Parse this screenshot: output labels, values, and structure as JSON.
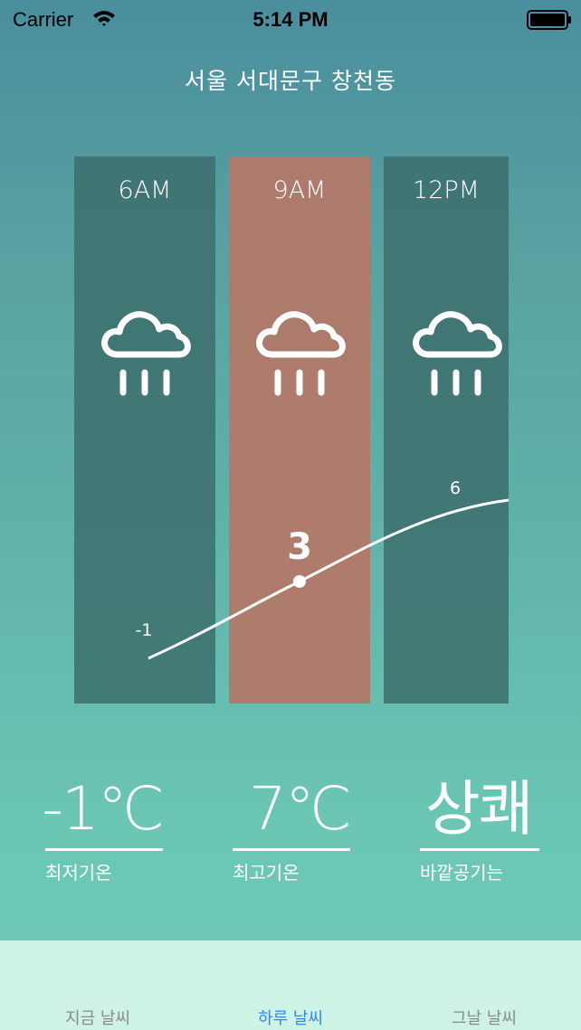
{
  "status_bar": {
    "carrier": "Carrier",
    "time": "5:14 PM"
  },
  "location": "서울 서대문구 창천동",
  "forecast": [
    {
      "time": "6AM",
      "icon": "rain-cloud-icon",
      "temp": "-1"
    },
    {
      "time": "9AM",
      "icon": "rain-cloud-icon",
      "temp": "3",
      "highlighted": true
    },
    {
      "time": "12PM",
      "icon": "rain-cloud-icon",
      "temp": "6"
    }
  ],
  "stats": [
    {
      "value": "-1℃",
      "label": "최저기온"
    },
    {
      "value": "7℃",
      "label": "최고기온"
    },
    {
      "value": "상쾌",
      "label": "바깥공기는"
    }
  ],
  "tabs": [
    {
      "label": "지금 날씨",
      "active": false
    },
    {
      "label": "하루 날씨",
      "active": true
    },
    {
      "label": "그날 날씨",
      "active": false
    }
  ],
  "colors": {
    "highlight_column": "#b27868",
    "column": "#3c6e6c",
    "active_tab": "#2f87f0",
    "inactive_tab": "#8a8a8a"
  }
}
